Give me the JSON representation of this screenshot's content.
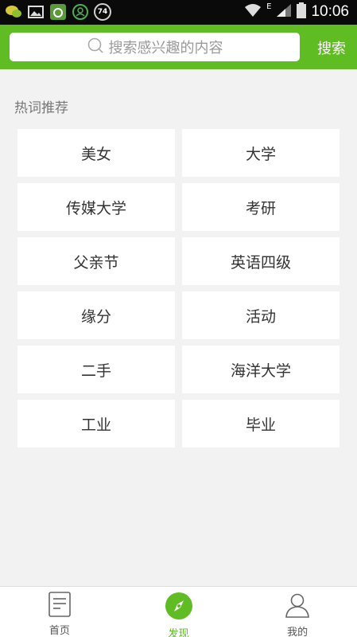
{
  "status_bar": {
    "time": "10:06",
    "network": "E",
    "notification_badge": "74",
    "icons": [
      "wechat-icon",
      "gallery-icon",
      "app-icon",
      "contact-icon",
      "badge-icon",
      "wifi-icon",
      "signal-icon",
      "battery-icon"
    ]
  },
  "search": {
    "placeholder": "搜索感兴趣的内容",
    "button_label": "搜索"
  },
  "hot": {
    "title": "热词推荐",
    "items": [
      "美女",
      "大学",
      "传媒大学",
      "考研",
      "父亲节",
      "英语四级",
      "缘分",
      "活动",
      "二手",
      "海洋大学",
      "工业",
      "毕业"
    ]
  },
  "nav": {
    "items": [
      {
        "label": "首页",
        "icon": "document-icon"
      },
      {
        "label": "发现",
        "icon": "compass-icon"
      },
      {
        "label": "我的",
        "icon": "user-icon"
      }
    ]
  },
  "colors": {
    "accent": "#5fbc22",
    "status_bar": "#0a0a0a",
    "background": "#f2f2f2"
  }
}
